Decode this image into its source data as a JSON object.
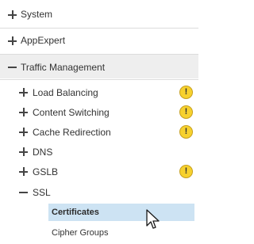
{
  "nav": {
    "items": [
      {
        "label": "System",
        "toggle": "+"
      },
      {
        "label": "AppExpert",
        "toggle": "+"
      },
      {
        "label": "Traffic Management",
        "toggle": "−"
      }
    ],
    "traffic_management": {
      "children": [
        {
          "label": "Load Balancing",
          "toggle": "+",
          "warning": true
        },
        {
          "label": "Content Switching",
          "toggle": "+",
          "warning": true
        },
        {
          "label": "Cache Redirection",
          "toggle": "+",
          "warning": true
        },
        {
          "label": "DNS",
          "toggle": "+",
          "warning": false
        },
        {
          "label": "GSLB",
          "toggle": "+",
          "warning": true
        },
        {
          "label": "SSL",
          "toggle": "−",
          "warning": false
        }
      ],
      "ssl_children": [
        {
          "label": "Certificates",
          "selected": true
        },
        {
          "label": "Cipher Groups",
          "selected": false
        }
      ]
    },
    "warning_glyph": "!",
    "icons": {
      "expand": "plus-icon",
      "collapse": "minus-icon",
      "warning": "warning-icon",
      "cursor": "mouse-pointer-icon"
    },
    "colors": {
      "selected_background": "#cde3f3",
      "section_background": "#eeeeee",
      "warning": "#f7d12e"
    }
  }
}
